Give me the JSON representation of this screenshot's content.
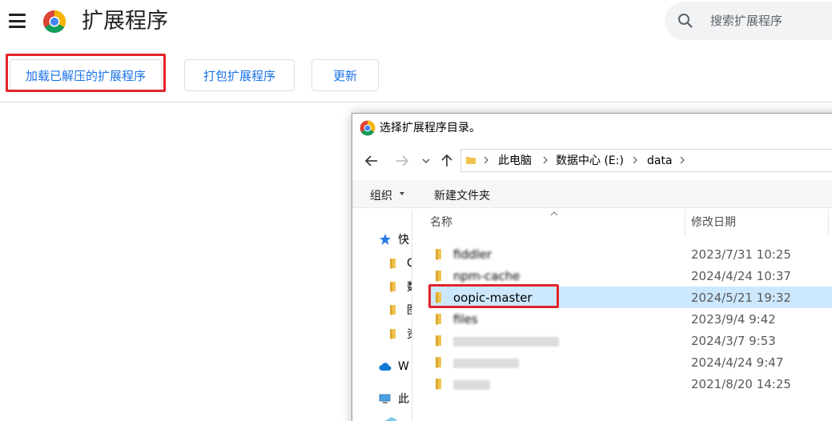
{
  "header": {
    "title": "扩展程序",
    "search_placeholder": "搜索扩展程序"
  },
  "toolbar": {
    "load_unpacked_label": "加载已解压的扩展程序",
    "pack_label": "打包扩展程序",
    "update_label": "更新"
  },
  "dialog": {
    "title": "选择扩展程序目录。",
    "breadcrumb": [
      "此电脑",
      "数据中心 (E:)",
      "data"
    ],
    "organize_label": "组织",
    "new_folder_label": "新建文件夹",
    "columns": {
      "name": "名称",
      "date_modified": "修改日期"
    },
    "left_pane": [
      {
        "label": "快",
        "icon": "star-icon"
      },
      {
        "label": "C",
        "icon": "folder-icon"
      },
      {
        "label": "数",
        "icon": "folder-icon"
      },
      {
        "label": "图",
        "icon": "folder-icon"
      },
      {
        "label": "资",
        "icon": "folder-icon"
      },
      {
        "label": "W",
        "icon": "cloud-icon"
      },
      {
        "label": "此",
        "icon": "computer-icon"
      }
    ],
    "files": [
      {
        "name": "fiddler",
        "date": "2023/7/31 10:25",
        "blurred": true
      },
      {
        "name": "npm-cache",
        "date": "2024/4/24 10:37",
        "blurred": true
      },
      {
        "name": "oopic-master",
        "date": "2024/5/21 19:32",
        "blurred": false,
        "selected": true
      },
      {
        "name": "files",
        "date": "2023/9/4 9:42",
        "blurred": true
      },
      {
        "name": "",
        "date": "2024/3/7 9:53",
        "blurred": true
      },
      {
        "name": "",
        "date": "2024/4/24 9:47",
        "blurred": true
      },
      {
        "name": "",
        "date": "2021/8/20 14:25",
        "blurred": true
      }
    ]
  },
  "colors": {
    "accent": "#1a73e8",
    "highlight": "#e3242b",
    "selection": "#cce8ff"
  }
}
